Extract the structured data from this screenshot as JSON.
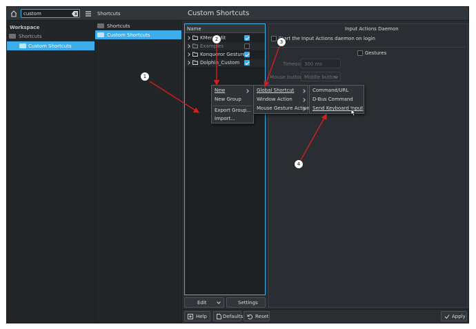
{
  "sidebar": {
    "search_value": "custom",
    "section_label": "Workspace",
    "items": [
      {
        "label": "Shortcuts"
      },
      {
        "label": "Custom Shortcuts"
      }
    ]
  },
  "middle": {
    "title": "Shortcuts",
    "items": [
      {
        "label": "Shortcuts"
      },
      {
        "label": "Custom Shortcuts"
      }
    ]
  },
  "main": {
    "title": "Custom Shortcuts",
    "tree": {
      "header": "Name",
      "rows": [
        {
          "label": "KMenuEdit",
          "checked": true
        },
        {
          "label": "Examples",
          "checked": false
        },
        {
          "label": "Konqueror Gestures",
          "checked": true
        },
        {
          "label": "Dolphin_Custom",
          "checked": true
        }
      ]
    },
    "edit_label": "Edit",
    "settings_label": "Settings",
    "daemon": {
      "group_title": "Input Actions Daemon",
      "start_label": "Start the Input Actions daemon on login"
    },
    "gestures": {
      "label": "Gestures",
      "timeout_label": "Timeout:",
      "timeout_value": "300 ms",
      "mouse_button_label": "Mouse button:",
      "mouse_button_value": "Middle button"
    },
    "menu1": [
      "New",
      "New Group",
      "Export Group...",
      "Import..."
    ],
    "menu2": [
      "Global Shortcut",
      "Window Action",
      "Mouse Gesture Action"
    ],
    "menu3": [
      "Command/URL",
      "D-Bus Command",
      "Send Keyboard Input"
    ]
  },
  "footer": {
    "help": "Help",
    "defaults": "Defaults",
    "reset": "Reset",
    "apply": "Apply"
  },
  "callouts": [
    "1",
    "2",
    "3",
    "4"
  ],
  "colors": {
    "accent": "#3daee9",
    "annotation": "#d21e1e",
    "background": "#2a2e32"
  }
}
